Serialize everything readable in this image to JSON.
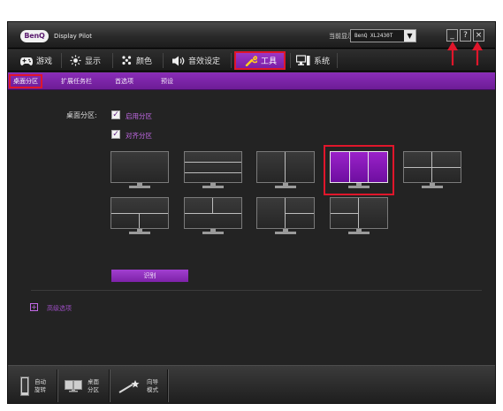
{
  "titlebar": {
    "logo": "BenQ",
    "title": "Display Pilot",
    "display_label": "当前显示",
    "display_value": "BenQ XL2430T",
    "minimize": "_",
    "help": "?",
    "close": "×"
  },
  "tabs": [
    {
      "label": "游戏",
      "icon": "gamepad-icon"
    },
    {
      "label": "显示",
      "icon": "brightness-icon"
    },
    {
      "label": "颜色",
      "icon": "color-dots-icon"
    },
    {
      "label": "音效设定",
      "icon": "speaker-icon"
    },
    {
      "label": "工具",
      "icon": "wrench-icon",
      "active": true
    },
    {
      "label": "系统",
      "icon": "system-icon"
    }
  ],
  "subtabs": [
    {
      "label": "桌面分区",
      "active": true
    },
    {
      "label": "扩展任务栏"
    },
    {
      "label": "首选项"
    },
    {
      "label": "预设"
    }
  ],
  "partition": {
    "label": "桌面分区:",
    "enable_label": "启用分区",
    "align_label": "对齐分区",
    "enable_checked": true,
    "align_checked": true,
    "identify_label": "识别",
    "selected_layout": 4
  },
  "advanced": {
    "toggle": "+",
    "label": "高级选项"
  },
  "footer": [
    {
      "line1": "自动",
      "line2": "旋转",
      "icon": "rotate-monitor-icon"
    },
    {
      "line1": "桌面",
      "line2": "分区",
      "icon": "desktop-partition-icon"
    },
    {
      "line1": "向导",
      "line2": "模式",
      "icon": "wizard-wand-icon"
    }
  ],
  "colors": {
    "accent_purple": "#8a2db8",
    "highlight_red": "#e0162b",
    "label_purple": "#c46ae8"
  }
}
